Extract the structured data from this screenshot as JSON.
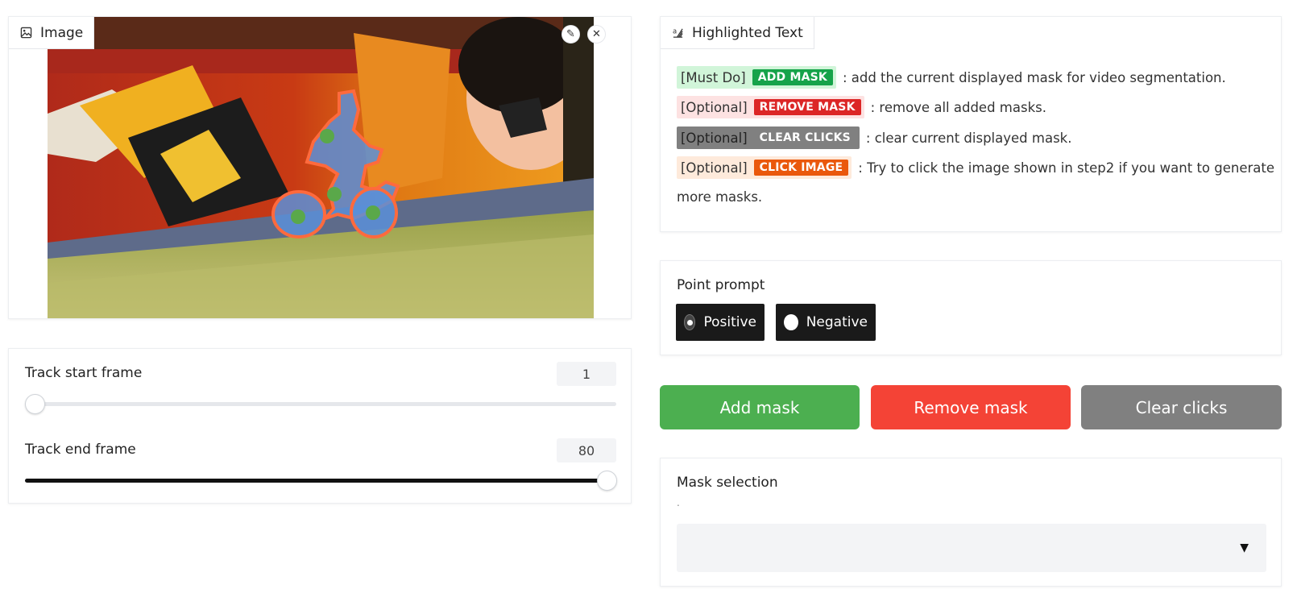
{
  "image_panel": {
    "label": "Image",
    "label_icon": "image-icon",
    "edit_icon": "pencil-icon",
    "close_icon": "close-icon"
  },
  "sliders": {
    "start": {
      "label": "Track start frame",
      "value": "1",
      "fraction": 0.0
    },
    "end": {
      "label": "Track end frame",
      "value": "80",
      "fraction": 1.0
    }
  },
  "highlighted_text": {
    "label": "Highlighted Text",
    "label_icon": "highlight-icon",
    "lines": [
      {
        "category": "[Must Do]",
        "badge": "ADD MASK",
        "desc": ": add the current displayed mask for video segmentation.",
        "bg": "#d1f5d9",
        "badge_color": "#16a34a"
      },
      {
        "category": "[Optional]",
        "badge": "REMOVE MASK",
        "desc": ": remove all added masks.",
        "bg": "#fde2e2",
        "badge_color": "#dc2626"
      },
      {
        "category": "[Optional]",
        "badge": "CLEAR CLICKS",
        "desc": ": clear current displayed mask.",
        "bg": "#808080",
        "badge_color": "#808080"
      },
      {
        "category": "[Optional]",
        "badge": "CLICK IMAGE",
        "desc": ": Try to click the image shown in step2 if you want to generate",
        "bg": "#feeadb",
        "badge_color": "#ea580c"
      }
    ],
    "wrap_line": "more masks."
  },
  "point_prompt": {
    "label": "Point prompt",
    "options": [
      "Positive",
      "Negative"
    ],
    "selected": "Positive"
  },
  "buttons": {
    "add_mask": "Add mask",
    "remove_mask": "Remove mask",
    "clear_clicks": "Clear clicks"
  },
  "colors": {
    "add_mask": "#4caf50",
    "remove_mask": "#f44336",
    "clear_clicks": "#808080"
  },
  "mask_selection": {
    "label": "Mask selection",
    "note": ".",
    "value": "",
    "caret_icon": "caret-down-icon"
  }
}
